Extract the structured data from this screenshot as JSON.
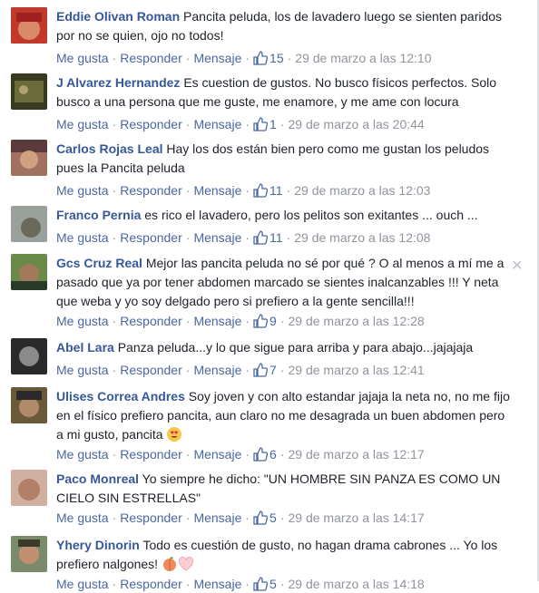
{
  "labels": {
    "like": "Me gusta",
    "reply": "Responder",
    "message": "Mensaje"
  },
  "comments": [
    {
      "author": "Eddie Olivan Roman",
      "text": "Pancita peluda, los de lavadero luego se sienten paridos por no se quien, ojo no todos!",
      "likes": "15",
      "time": "29 de marzo a las 12:10",
      "avatar_color": "#c0392b"
    },
    {
      "author": "J Alvarez Hernandez",
      "text": "Es cuestion de gustos. No busco físicos perfectos. Solo busco a una persona que me guste, me enamore, y me ame con locura",
      "likes": "1",
      "time": "29 de marzo a las 20:44",
      "avatar_color": "#4a4a2e"
    },
    {
      "author": "Carlos Rojas Leal",
      "text": "Hay los dos están bien pero como me gustan los peludos pues la Pancita peluda",
      "likes": "11",
      "time": "29 de marzo a las 12:03",
      "avatar_color": "#7b5a4a"
    },
    {
      "author": "Franco Pernia",
      "text": "es rico el lavadero, pero los pelitos son exitantes ... ouch ...",
      "likes": "11",
      "time": "29 de marzo a las 12:08",
      "avatar_color": "#8a8f8a"
    },
    {
      "author": "Gcs Cruz Real",
      "text": "Mejor las pancita peluda no sé por qué ? O al menos a mí me a pasado que ya por tener abdomen marcado se sientes inalcanzables !!! Y neta que weba y yo soy delgado pero si prefiero a la gente sencilla!!!",
      "likes": "9",
      "time": "29 de marzo a las 12:28",
      "avatar_color": "#5b7a3a"
    },
    {
      "author": "Abel Lara",
      "text": "Panza peluda...y lo que sigue para arriba y para abajo...jajajaja",
      "likes": "7",
      "time": "29 de marzo a las 12:41",
      "avatar_color": "#3a3a3a"
    },
    {
      "author": "Ulises Correa Andres",
      "text": "Soy joven y con alto estandar jajaja la neta no, no me fijo en el físico prefiero pancita, aun claro no me desagrada un buen abdomen pero a mi gusto, pancita",
      "likes": "6",
      "time": "29 de marzo a las 12:17",
      "avatar_color": "#7a5a3a"
    },
    {
      "author": "Paco Monreal",
      "text": "Yo siempre he dicho: \"UN HOMBRE SIN PANZA ES COMO UN CIELO SIN ESTRELLAS\"",
      "likes": "5",
      "time": "29 de marzo a las 14:17",
      "avatar_color": "#b08870"
    },
    {
      "author": "Yhery Dinorin",
      "text": "Todo es cuestión de gusto, no hagan drama cabrones ... Yo los prefiero nalgones!",
      "likes": "5",
      "time": "29 de marzo a las 14:18",
      "avatar_color": "#6a7a5a"
    }
  ],
  "icons": {
    "like": "thumbs-up-icon",
    "close": "close-icon",
    "heart_eyes": "heart-eyes-emoji",
    "peach": "peach-emoji",
    "heart": "heart-emoji"
  }
}
